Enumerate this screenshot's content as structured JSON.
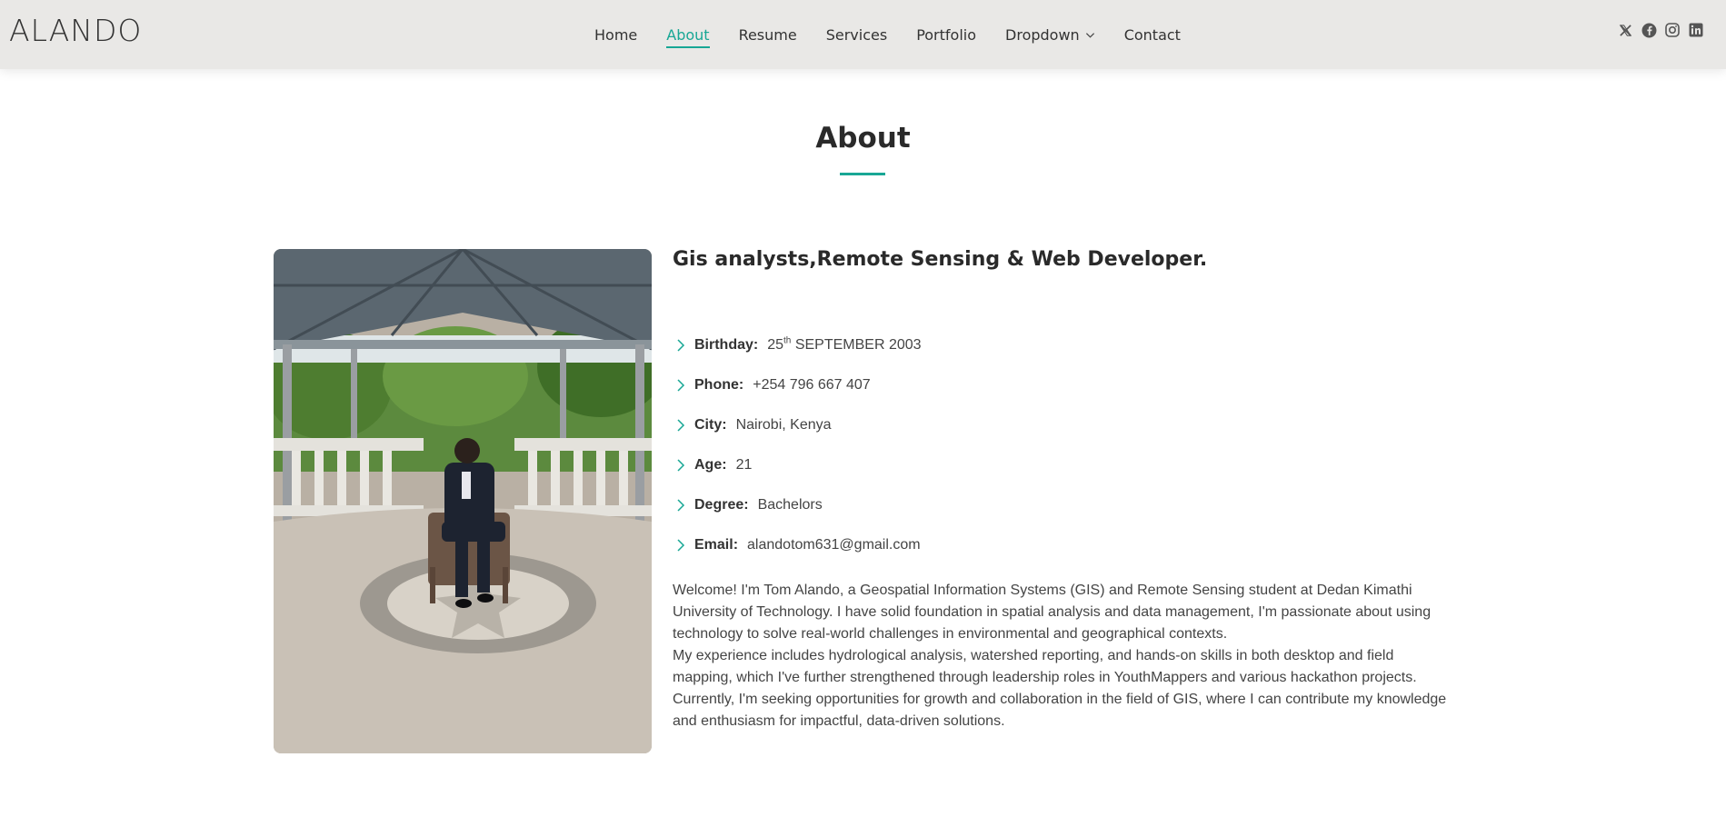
{
  "brand": {
    "logo": "ALANDO"
  },
  "nav": {
    "items": [
      {
        "label": "Home",
        "active": false
      },
      {
        "label": "About",
        "active": true
      },
      {
        "label": "Resume",
        "active": false
      },
      {
        "label": "Services",
        "active": false
      },
      {
        "label": "Portfolio",
        "active": false
      },
      {
        "label": "Dropdown",
        "active": false
      },
      {
        "label": "Contact",
        "active": false
      }
    ]
  },
  "social": [
    "x-icon",
    "facebook-icon",
    "instagram-icon",
    "linkedin-icon"
  ],
  "colors": {
    "accent": "#18a795",
    "header_bg": "#e9e8e6",
    "text": "#444444"
  },
  "about": {
    "title": "About",
    "headline": "Gis analysts,Remote Sensing & Web Developer.",
    "info": {
      "birthday": {
        "label": "Birthday:",
        "day": "25",
        "suffix": "th",
        "rest": " SEPTEMBER 2003"
      },
      "phone": {
        "label": "Phone:",
        "value": "+254 796 667 407"
      },
      "city": {
        "label": "City:",
        "value": "Nairobi, Kenya"
      },
      "age": {
        "label": "Age:",
        "value": "21"
      },
      "degree": {
        "label": "Degree:",
        "value": "Bachelors"
      },
      "email": {
        "label": "Email:",
        "value": "alandotom631@gmail.com"
      }
    },
    "bio": [
      "Welcome! I'm Tom Alando, a Geospatial Information Systems (GIS) and Remote Sensing student at Dedan Kimathi University of Technology. I have solid foundation in spatial analysis and data management, I'm passionate about using technology to solve real-world challenges in environmental and geographical contexts.",
      "My experience includes hydrological analysis, watershed reporting, and hands-on skills in both desktop and field mapping, which I've further strengthened through leadership roles in YouthMappers and various hackathon projects.",
      "Currently, I'm seeking opportunities for growth and collaboration in the field of GIS, where I can contribute my knowledge and enthusiasm for impactful, data-driven solutions."
    ]
  }
}
